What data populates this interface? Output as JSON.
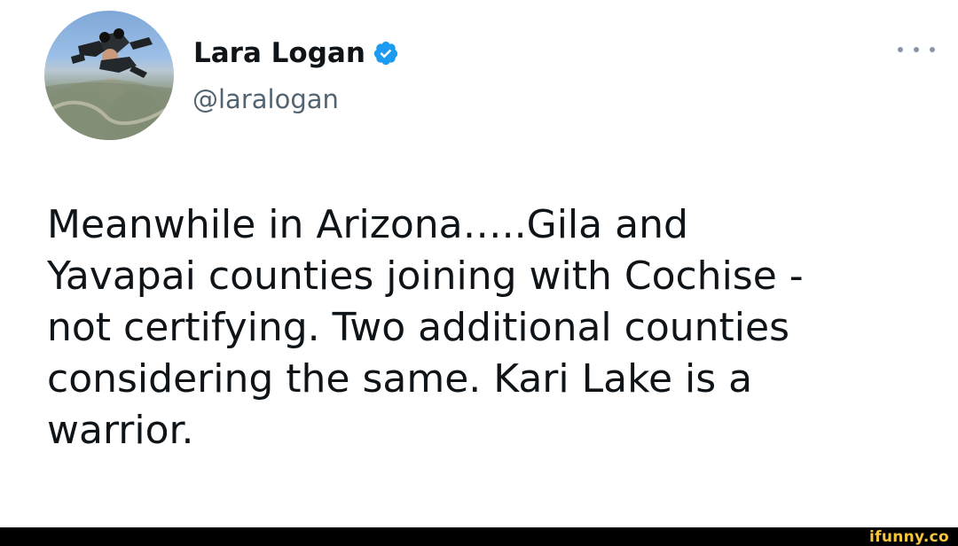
{
  "tweet": {
    "display_name": "Lara Logan",
    "handle": "@laralogan",
    "text": "Meanwhile in Arizona…..Gila and\nYavapai counties joining with Cochise -\nnot certifying. Two additional counties\nconsidering the same. Kari Lake is a\nwarrior.",
    "verified": true
  },
  "icons": {
    "verified": "verified-badge-icon",
    "more": "more-options-icon"
  },
  "colors": {
    "verified_blue": "#1d9bf0",
    "text": "#0f1419",
    "secondary_text": "#536471",
    "watermark": "#f5c53d"
  },
  "watermark": {
    "text": "ifunny.co"
  }
}
